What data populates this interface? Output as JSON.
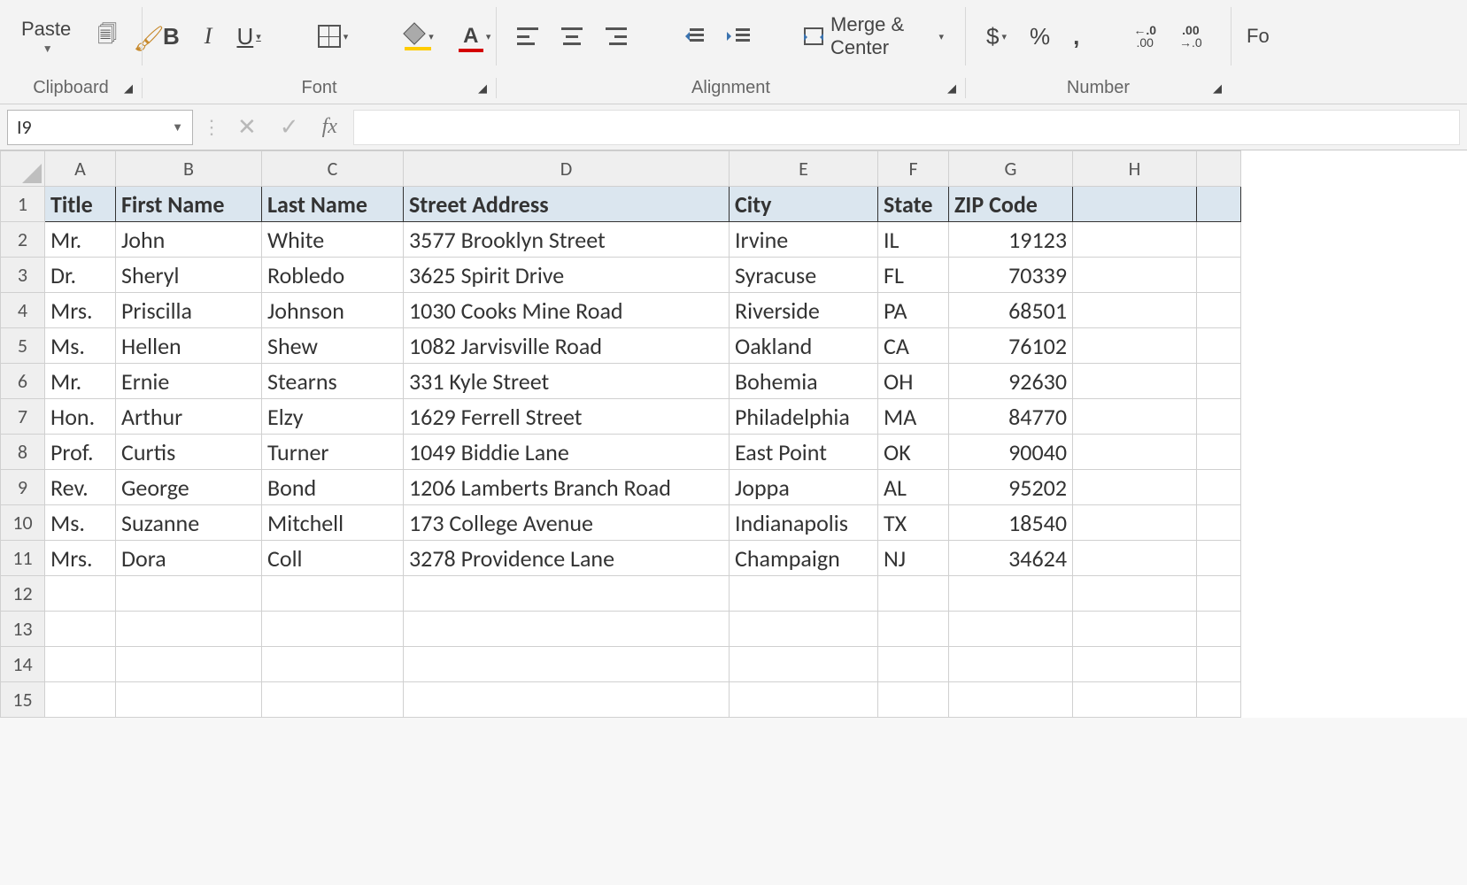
{
  "ribbon": {
    "paste_label": "Paste",
    "merge_label": "Merge & Center",
    "group_clipboard": "Clipboard",
    "group_font": "Font",
    "group_alignment": "Alignment",
    "group_number": "Number",
    "dollar": "$",
    "percent": "%",
    "comma": ",",
    "fo_fragment": "Fo",
    "dec_inc_top": "←.0",
    "dec_inc_bot": ".00",
    "dec_dec_top": ".00",
    "dec_dec_bot": "→.0"
  },
  "formula_bar": {
    "name_box": "I9",
    "fx": "fx",
    "value": ""
  },
  "sheet": {
    "column_letters": [
      "A",
      "B",
      "C",
      "D",
      "E",
      "F",
      "G",
      "H"
    ],
    "headers": [
      "Title",
      "First Name",
      "Last Name",
      "Street Address",
      "City",
      "State",
      "ZIP Code"
    ],
    "rows": [
      {
        "title": "Mr.",
        "first": "John",
        "last": "White",
        "street": "3577 Brooklyn Street",
        "city": "Irvine",
        "state": "IL",
        "zip": "19123"
      },
      {
        "title": "Dr.",
        "first": "Sheryl",
        "last": "Robledo",
        "street": "3625 Spirit Drive",
        "city": "Syracuse",
        "state": "FL",
        "zip": "70339"
      },
      {
        "title": "Mrs.",
        "first": "Priscilla",
        "last": "Johnson",
        "street": "1030 Cooks Mine Road",
        "city": "Riverside",
        "state": "PA",
        "zip": "68501"
      },
      {
        "title": "Ms.",
        "first": "Hellen",
        "last": "Shew",
        "street": "1082 Jarvisville Road",
        "city": "Oakland",
        "state": "CA",
        "zip": "76102"
      },
      {
        "title": "Mr.",
        "first": "Ernie",
        "last": "Stearns",
        "street": "331 Kyle Street",
        "city": "Bohemia",
        "state": "OH",
        "zip": "92630"
      },
      {
        "title": "Hon.",
        "first": "Arthur",
        "last": "Elzy",
        "street": "1629 Ferrell Street",
        "city": "Philadelphia",
        "state": "MA",
        "zip": "84770"
      },
      {
        "title": "Prof.",
        "first": "Curtis",
        "last": "Turner",
        "street": "1049 Biddie Lane",
        "city": "East Point",
        "state": "OK",
        "zip": "90040"
      },
      {
        "title": "Rev.",
        "first": "George",
        "last": "Bond",
        "street": "1206 Lamberts Branch Road",
        "city": "Joppa",
        "state": "AL",
        "zip": "95202"
      },
      {
        "title": "Ms.",
        "first": "Suzanne",
        "last": "Mitchell",
        "street": "173 College Avenue",
        "city": "Indianapolis",
        "state": "TX",
        "zip": "18540"
      },
      {
        "title": "Mrs.",
        "first": "Dora",
        "last": "Coll",
        "street": "3278 Providence Lane",
        "city": "Champaign",
        "state": "NJ",
        "zip": "34624"
      }
    ],
    "empty_rows_after": 4
  }
}
